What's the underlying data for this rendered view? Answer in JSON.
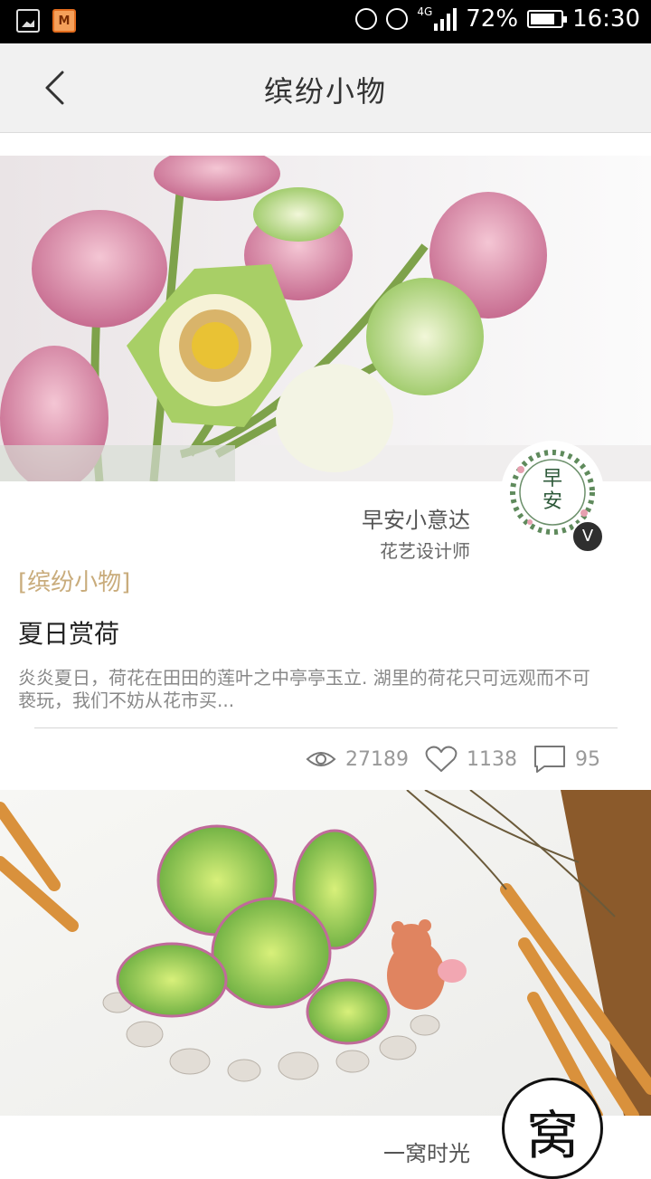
{
  "status_bar": {
    "battery": "72%",
    "time": "16:30",
    "network": "4G"
  },
  "nav": {
    "title": "缤纷小物"
  },
  "posts": [
    {
      "author_name": "早安小意达",
      "author_title": "花艺设计师",
      "avatar_text": "早安",
      "verified_badge": "V",
      "category": "[缤纷小物]",
      "title": "夏日赏荷",
      "excerpt": "炎炎夏日，荷花在田田的莲叶之中亭亭玉立. 湖里的荷花只可远观而不可亵玩，我们不妨从花市买...",
      "views": "27189",
      "likes": "1138",
      "comments": "95"
    },
    {
      "author_name": "一窝时光",
      "avatar_text": "窝"
    }
  ],
  "colors": {
    "accent_category": "#c9ac7c",
    "navbar_bg": "#f1f1f1"
  }
}
